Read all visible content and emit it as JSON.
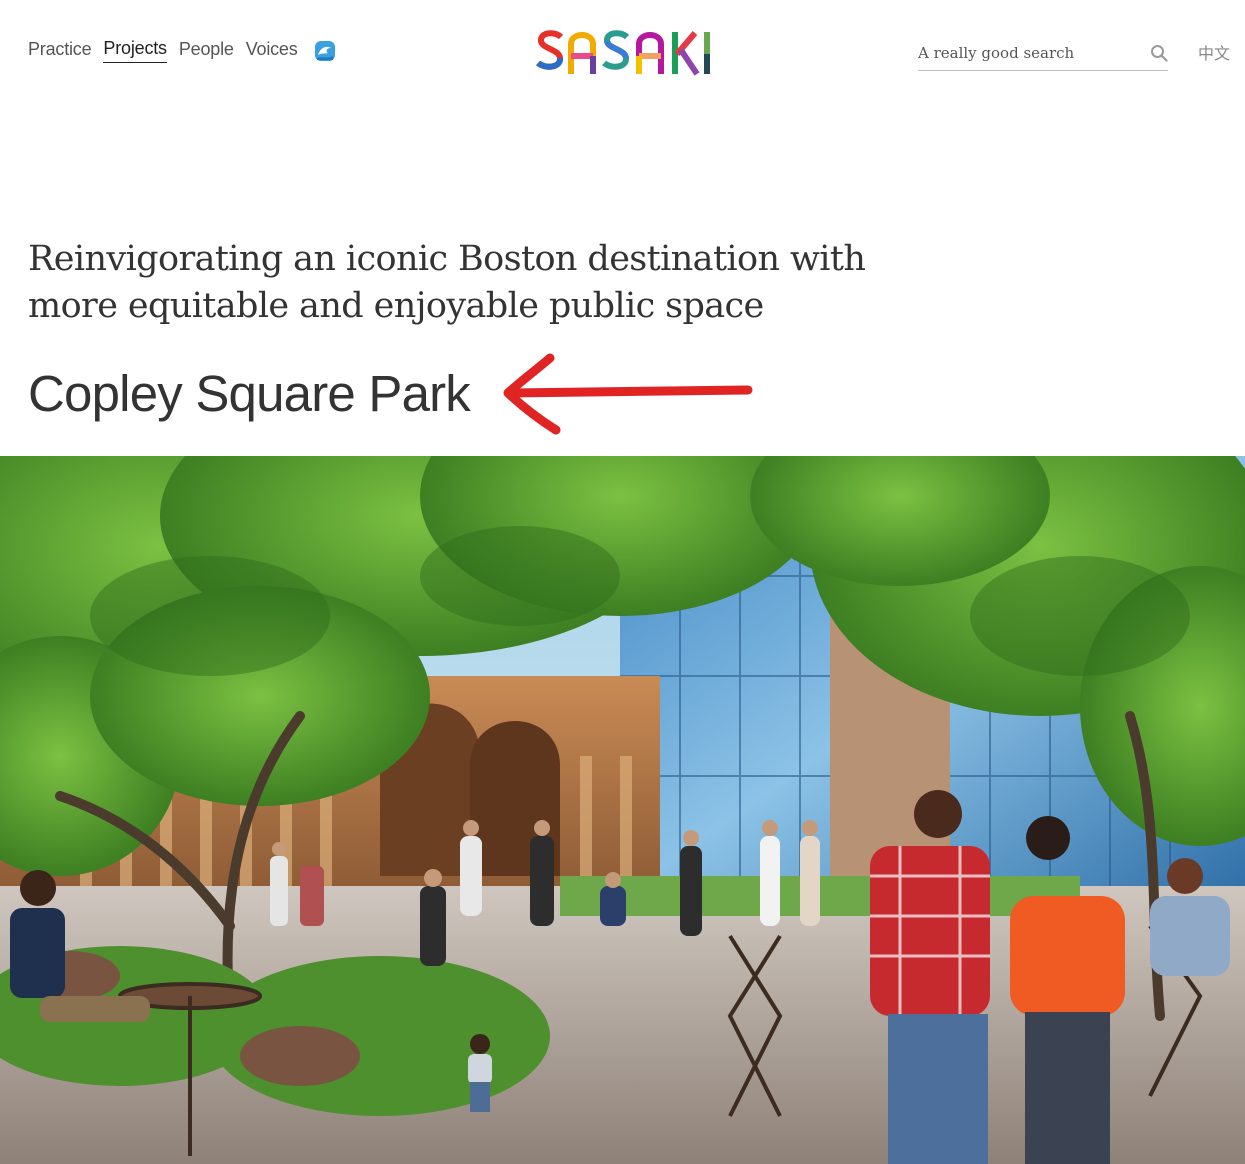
{
  "nav": {
    "items": [
      {
        "label": "Practice",
        "active": false
      },
      {
        "label": "Projects",
        "active": true
      },
      {
        "label": "People",
        "active": false
      },
      {
        "label": "Voices",
        "active": false
      }
    ],
    "extra_icon": "wave-icon"
  },
  "logo": {
    "text": "SASAKI"
  },
  "search": {
    "placeholder": "A really good search",
    "icon": "search-icon"
  },
  "language": {
    "label": "中文"
  },
  "project": {
    "tagline": "Reinvigorating an iconic Boston destination with more equitable and enjoyable public space",
    "title": "Copley Square Park"
  },
  "annotation": {
    "type": "arrow",
    "color": "#e02424"
  },
  "hero_image": {
    "description_icon": "park-rendering-image"
  },
  "colors": {
    "text": "#333333",
    "nav": "#555555",
    "arrow": "#e02424",
    "foliage": "#4f9a2e",
    "sky": "#7fb8d8"
  }
}
